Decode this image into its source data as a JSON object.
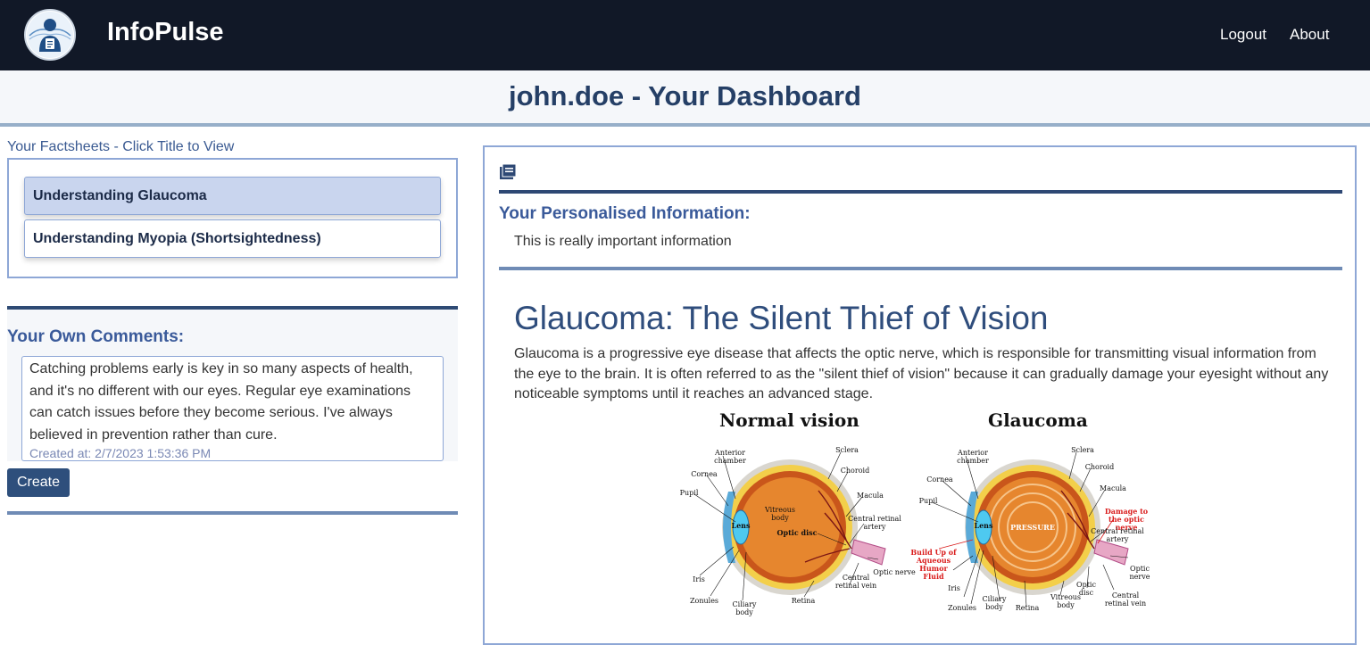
{
  "header": {
    "brand": "InfoPulse",
    "nav": {
      "logout": "Logout",
      "about": "About"
    }
  },
  "dashboard": {
    "title": "john.doe - Your Dashboard"
  },
  "factsheets": {
    "heading": "Your Factsheets - Click Title to View",
    "items": [
      {
        "label": "Understanding Glaucoma",
        "active": true
      },
      {
        "label": "Understanding Myopia (Shortsightedness)",
        "active": false
      }
    ]
  },
  "comments": {
    "heading": "Your Own Comments:",
    "items": [
      {
        "text": "Catching problems early is key in so many aspects of health, and it's no different with our eyes. Regular eye examinations can catch issues before they become serious. I've always believed in prevention rather than cure.",
        "created": "Created at: 2/7/2023 1:53:36 PM"
      }
    ],
    "create_label": "Create"
  },
  "personal": {
    "heading": "Your Personalised Information:",
    "text": "This is really important information"
  },
  "article": {
    "title": "Glaucoma: The Silent Thief of Vision",
    "body": "Glaucoma is a progressive eye disease that affects the optic nerve, which is responsible for transmitting visual information from the eye to the brain. It is often referred to as the \"silent thief of vision\" because it can gradually damage your eyesight without any noticeable symptoms until it reaches an advanced stage."
  },
  "figure": {
    "titles": {
      "normal": "Normal vision",
      "glaucoma": "Glaucoma"
    },
    "normal_labels": {
      "anterior": "Anterior chamber",
      "cornea": "Cornea",
      "pupil": "Pupil",
      "lens": "Lens",
      "vitreous": "Vitreous body",
      "sclera": "Sclera",
      "choroid": "Choroid",
      "macula": "Macula",
      "optic_disc": "Optic disc",
      "central_artery": "Central retinal artery",
      "optic_nerve": "Optic nerve",
      "central_vein": "Central retinal vein",
      "iris": "Iris",
      "zonules": "Zonules",
      "ciliary": "Ciliary body",
      "retina": "Retina"
    },
    "glaucoma_labels": {
      "anterior": "Anterior chamber",
      "cornea": "Cornea",
      "pupil": "Pupil",
      "lens": "Lens",
      "pressure": "PRESSURE",
      "sclera": "Sclera",
      "choroid": "Choroid",
      "macula": "Macula",
      "damage": "Damage to the optic nerve",
      "central_artery": "Central retinal artery",
      "buildup": "Build Up of Aqueous Humor Fluid",
      "optic_nerve": "Optic nerve",
      "iris": "Iris",
      "zonules": "Zonules",
      "ciliary": "Ciliary body",
      "retina": "Retina",
      "vitreous": "Vitreous body",
      "optic_disc": "Optic disc",
      "central_vein": "Central retinal vein"
    }
  },
  "colors": {
    "topbar": "#111827",
    "title": "#253f66",
    "accent": "#3a5a9a",
    "active_item": "#c9d5ee",
    "button": "#2e4f7c"
  },
  "icons": {
    "logo": "doctor-logo-icon",
    "panel": "book-icon"
  }
}
